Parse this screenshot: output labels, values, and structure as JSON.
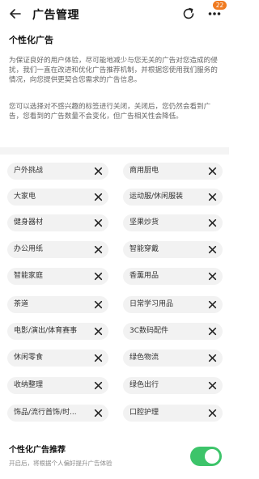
{
  "header": {
    "title": "广告管理",
    "badge": "22"
  },
  "section": {
    "title": "个性化广告",
    "desc1": "为保证良好的用户体验，尽可能地减少与您无关的广告对您造成的侵扰，我们一直在改进和优化广告推荐机制，并根据您使用我们服务的情况，向您提供更契合您需求的广告信息。",
    "desc2": "您可以选择对不感兴趣的标签进行关闭，关闭后，您仍然会看到广告，您看到的广告数量不会变化，但广告相关性会降低。"
  },
  "tags": [
    {
      "label": "户外挑战"
    },
    {
      "label": "商用厨电"
    },
    {
      "label": "大家电"
    },
    {
      "label": "运动服/休闲服装"
    },
    {
      "label": "健身器材"
    },
    {
      "label": "坚果炒货"
    },
    {
      "label": "办公用纸"
    },
    {
      "label": "智能穿戴"
    },
    {
      "label": "智能家庭"
    },
    {
      "label": "香薰用品"
    },
    {
      "label": "茶道"
    },
    {
      "label": "日常学习用品"
    },
    {
      "label": "电影/演出/体育赛事"
    },
    {
      "label": "3C数码配件"
    },
    {
      "label": "休闲零食"
    },
    {
      "label": "绿色物流"
    },
    {
      "label": "收纳整理"
    },
    {
      "label": "绿色出行"
    },
    {
      "label": "饰品/流行首饰/时..."
    },
    {
      "label": "口腔护理"
    }
  ],
  "toggle": {
    "title": "个性化广告推荐",
    "subtitle": "开启后，将根据个人偏好提升广告体验",
    "enabled": true
  },
  "colors": {
    "badge": "#f07b21",
    "toggle_on": "#3dc46a",
    "tag_bg": "#f2f2f2"
  },
  "icons": [
    "back-arrow-icon",
    "refresh-icon",
    "more-icon",
    "close-icon"
  ]
}
